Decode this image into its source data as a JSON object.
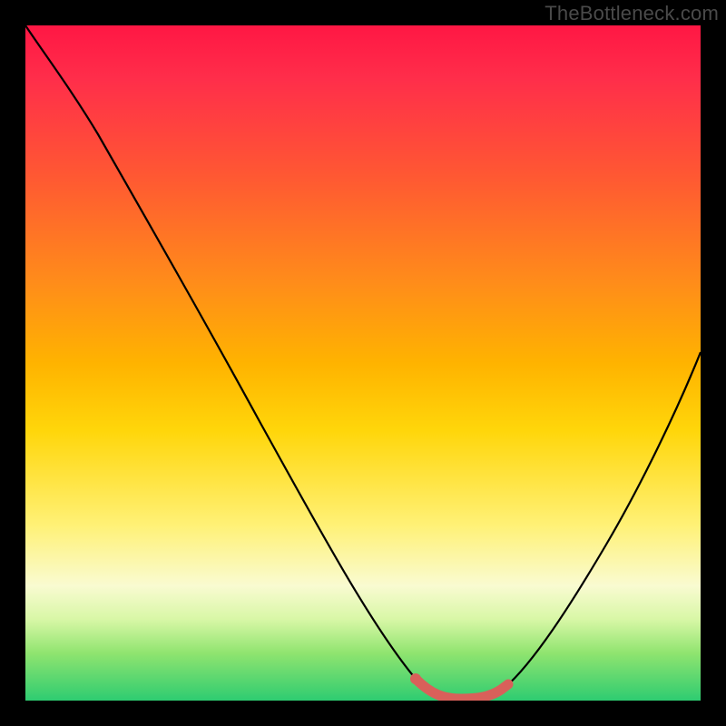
{
  "watermark": "TheBottleneck.com",
  "chart_data": {
    "type": "line",
    "title": "",
    "xlabel": "",
    "ylabel": "",
    "xlim": [
      0,
      100
    ],
    "ylim": [
      0,
      100
    ],
    "series": [
      {
        "name": "bottleneck-curve",
        "x": [
          0,
          5,
          10,
          15,
          20,
          25,
          30,
          35,
          40,
          45,
          50,
          55,
          58,
          62,
          66,
          70,
          75,
          80,
          85,
          90,
          95,
          100
        ],
        "y": [
          100,
          95,
          89,
          82,
          75,
          67,
          59,
          51,
          42,
          33,
          24,
          14,
          6,
          1,
          0,
          1,
          6,
          14,
          24,
          35,
          47,
          60
        ]
      }
    ],
    "highlight": {
      "name": "optimal-range",
      "x": [
        58,
        60,
        62,
        64,
        66,
        68,
        70,
        71
      ],
      "y": [
        6,
        3,
        1,
        0.3,
        0,
        0.4,
        1,
        2.2
      ],
      "color": "#d9605a"
    },
    "background_gradient": {
      "stops": [
        {
          "pos": 0,
          "color": "#ff1744"
        },
        {
          "pos": 50,
          "color": "#ffb300"
        },
        {
          "pos": 74,
          "color": "#fff176"
        },
        {
          "pos": 88,
          "color": "#d8f7a6"
        },
        {
          "pos": 100,
          "color": "#2ecc71"
        }
      ]
    }
  }
}
